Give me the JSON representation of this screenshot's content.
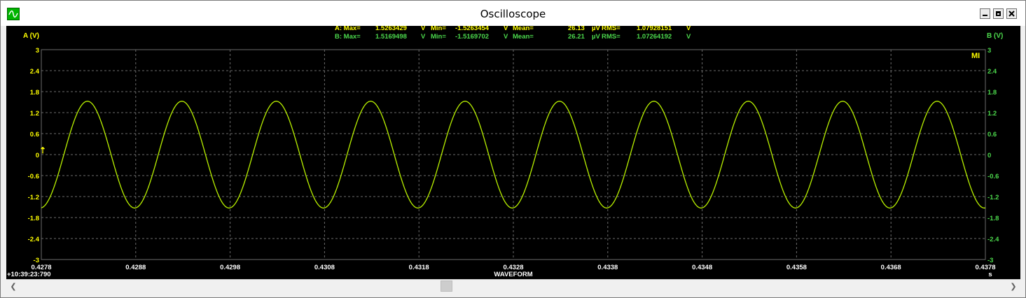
{
  "window": {
    "title": "Oscilloscope"
  },
  "scope": {
    "y_left_label": "A (V)",
    "y_right_label": "B (V)",
    "y_ticks": [
      "3",
      "2.4",
      "1.8",
      "1.2",
      "0.6",
      "0",
      "-0.6",
      "-1.2",
      "-1.8",
      "-2.4",
      "-3"
    ],
    "x_ticks": [
      "0.4278",
      "0.4288",
      "0.4298",
      "0.4308",
      "0.4318",
      "0.4328",
      "0.4338",
      "0.4348",
      "0.4358",
      "0.4368",
      "0.4378"
    ],
    "x_unit": "s",
    "x_label": "WAVEFORM",
    "time_stamp": "+10:39:23:790",
    "mode_badge": "MI",
    "marker": "⇡",
    "stats": {
      "a": {
        "max_label": "A: Max=",
        "max": "1.5263429",
        "v1": "V",
        "min_label": "Min=",
        "min": "-1.5263454",
        "v2": "V",
        "mean_label": "Mean=",
        "mean": "26.13",
        "mean_unit": "µV",
        "rms_label": "RMS=",
        "rms": "1.07928151",
        "rms_unit": "V"
      },
      "b": {
        "max_label": "B: Max=",
        "max": "1.5169498",
        "v1": "V",
        "min_label": "Min=",
        "min": "-1.5169702",
        "v2": "V",
        "mean_label": "Mean=",
        "mean": "26.21",
        "mean_unit": "µV",
        "rms_label": "RMS=",
        "rms": "1.07264192",
        "rms_unit": "V"
      }
    }
  },
  "colors": {
    "background": "#000000",
    "grid": "#6b6b6b",
    "axis_a": "#ffff00",
    "axis_b": "#4cd94c",
    "trace": "#b8f000"
  },
  "chart_data": {
    "type": "line",
    "x_range": [
      0.4278,
      0.4378
    ],
    "ylim": [
      -3,
      3
    ],
    "grid": true,
    "series": [
      {
        "name": "A",
        "amplitude": 1.5263429,
        "period": 0.001,
        "phase_at_start": -1.5,
        "color": "#b8f000"
      }
    ]
  }
}
